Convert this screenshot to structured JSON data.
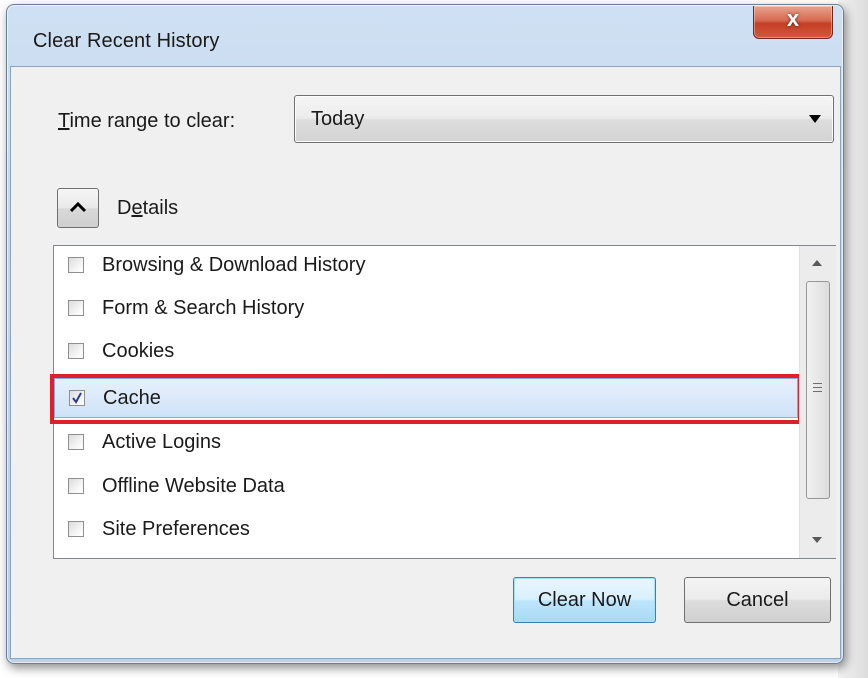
{
  "window": {
    "title": "Clear Recent History",
    "close_label": "x"
  },
  "time_range": {
    "label_prefix": "T",
    "label_rest": "ime range to clear:",
    "selected": "Today"
  },
  "details": {
    "label_pre": "D",
    "label_underlined": "e",
    "label_post": "tails",
    "expanded": true
  },
  "items": [
    {
      "label": "Browsing & Download History",
      "checked": false
    },
    {
      "label": "Form & Search History",
      "checked": false
    },
    {
      "label": "Cookies",
      "checked": false
    },
    {
      "label": "Cache",
      "checked": true,
      "selected": true
    },
    {
      "label": "Active Logins",
      "checked": false
    },
    {
      "label": "Offline Website Data",
      "checked": false
    },
    {
      "label": "Site Preferences",
      "checked": false
    }
  ],
  "buttons": {
    "clear_now": "Clear Now",
    "cancel": "Cancel"
  },
  "colors": {
    "highlight_border": "#e01f2a",
    "selection_bg": "#cfe3f8",
    "close_button": "#c43f25"
  }
}
